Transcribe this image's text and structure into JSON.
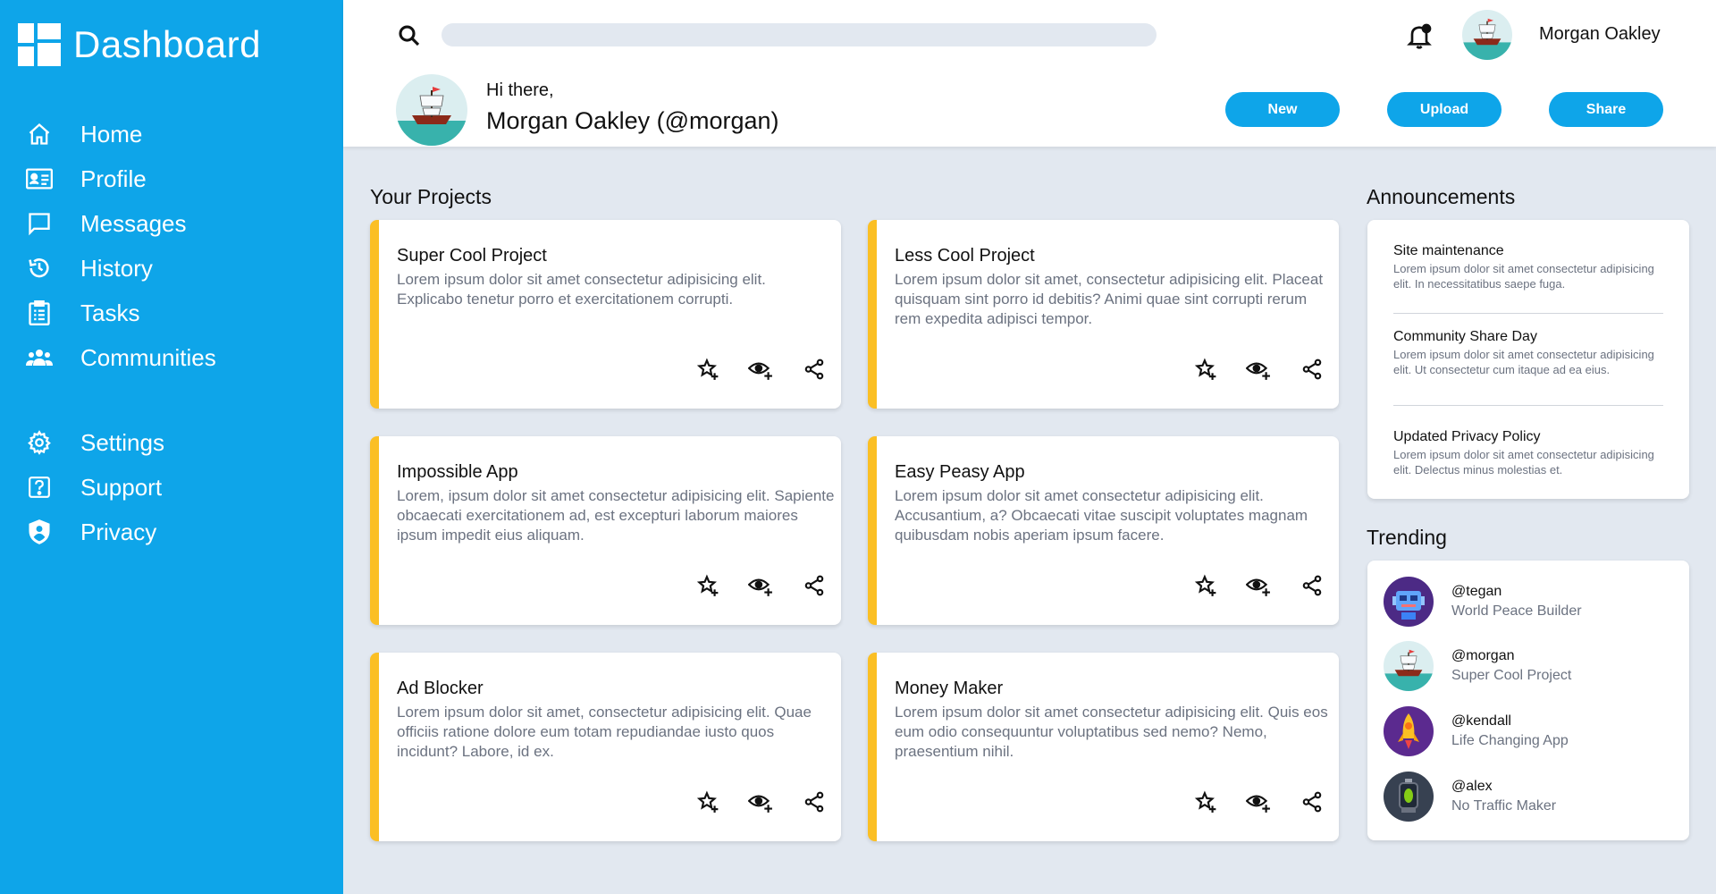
{
  "brand": {
    "title": "Dashboard"
  },
  "nav": {
    "primary": [
      {
        "label": "Home",
        "icon": "home-icon"
      },
      {
        "label": "Profile",
        "icon": "id-card-icon"
      },
      {
        "label": "Messages",
        "icon": "chat-icon"
      },
      {
        "label": "History",
        "icon": "history-icon"
      },
      {
        "label": "Tasks",
        "icon": "clipboard-icon"
      },
      {
        "label": "Communities",
        "icon": "people-icon"
      }
    ],
    "secondary": [
      {
        "label": "Settings",
        "icon": "gear-icon"
      },
      {
        "label": "Support",
        "icon": "help-icon"
      },
      {
        "label": "Privacy",
        "icon": "shield-icon"
      }
    ]
  },
  "header": {
    "search_placeholder": "",
    "user_name": "Morgan Oakley",
    "greeting": "Hi there,",
    "full_name": "Morgan Oakley (@morgan)",
    "buttons": {
      "new": "New",
      "upload": "Upload",
      "share": "Share"
    }
  },
  "projects": {
    "title": "Your Projects",
    "items": [
      {
        "title": "Super Cool Project",
        "desc": "Lorem ipsum dolor sit amet consectetur adipisicing elit. Explicabo tenetur porro et exercitationem corrupti."
      },
      {
        "title": "Less Cool Project",
        "desc": "Lorem ipsum dolor sit amet, consectetur adipisicing elit. Placeat quisquam sint porro id debitis? Animi quae sint corrupti rerum rem expedita adipisci tempor."
      },
      {
        "title": "Impossible App",
        "desc": "Lorem, ipsum dolor sit amet consectetur adipisicing elit. Sapiente obcaecati exercitationem ad, est excepturi laborum maiores ipsum impedit eius aliquam."
      },
      {
        "title": "Easy Peasy App",
        "desc": "Lorem ipsum dolor sit amet consectetur adipisicing elit. Accusantium, a? Obcaecati vitae suscipit voluptates magnam quibusdam nobis aperiam ipsum facere."
      },
      {
        "title": "Ad Blocker",
        "desc": "Lorem ipsum dolor sit amet, consectetur adipisicing elit. Quae officiis ratione dolore eum totam repudiandae iusto quos incidunt? Labore, id ex."
      },
      {
        "title": "Money Maker",
        "desc": "Lorem ipsum dolor sit amet consectetur adipisicing elit. Quis eos eum odio consequuntur voluptatibus sed nemo? Nemo, praesentium nihil."
      }
    ]
  },
  "announcements": {
    "title": "Announcements",
    "items": [
      {
        "title": "Site maintenance",
        "desc": "Lorem ipsum dolor sit amet consectetur adipisicing elit. In necessitatibus saepe fuga."
      },
      {
        "title": "Community Share Day",
        "desc": "Lorem ipsum dolor sit amet consectetur adipisicing elit. Ut consectetur cum itaque ad ea eius."
      },
      {
        "title": "Updated Privacy Policy",
        "desc": "Lorem ipsum dolor sit amet consectetur adipisicing elit. Delectus minus molestias et."
      }
    ]
  },
  "trending": {
    "title": "Trending",
    "items": [
      {
        "handle": "@tegan",
        "project": "World Peace Builder"
      },
      {
        "handle": "@morgan",
        "project": "Super Cool Project"
      },
      {
        "handle": "@kendall",
        "project": "Life Changing App"
      },
      {
        "handle": "@alex",
        "project": "No Traffic Maker"
      }
    ]
  },
  "colors": {
    "sidebar": "#0ea5e9",
    "accent": "#fbbf24",
    "background": "#e2e8f0"
  }
}
